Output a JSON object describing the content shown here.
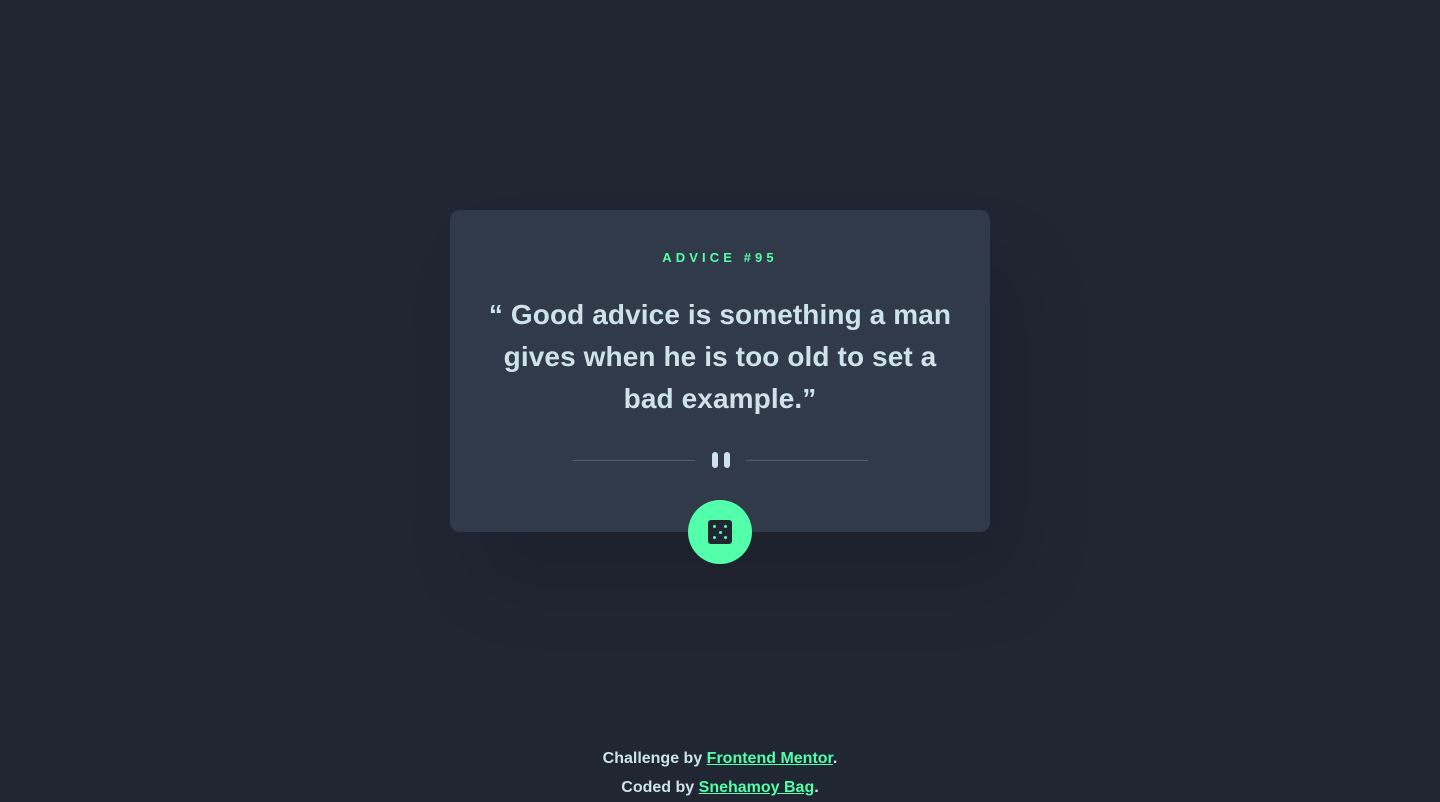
{
  "card": {
    "advice_label": "ADVICE #95",
    "quote": "“ Good advice is something a man gives when he is too old to set a bad example.”"
  },
  "divider": {
    "icon": "pause-icon"
  },
  "dice_button": {
    "icon": "dice-icon"
  },
  "footer": {
    "line1_prefix": "Challenge by ",
    "line1_link": "Frontend Mentor",
    "line1_suffix": ".",
    "line2_prefix": "Coded by ",
    "line2_link": "Snehamoy Bag",
    "line2_suffix": "."
  },
  "colors": {
    "background": "#202632",
    "card": "#313a48",
    "accent": "#53ffaa",
    "text": "#cee3e9",
    "divider": "#4f5d74"
  }
}
